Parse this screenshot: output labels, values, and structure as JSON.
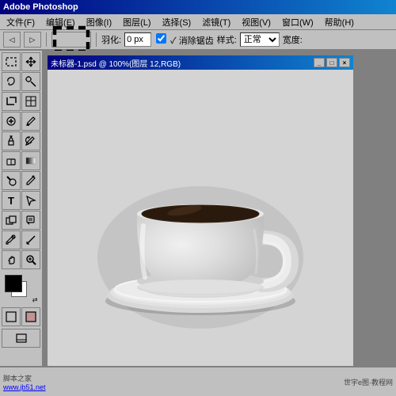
{
  "titleBar": {
    "label": "Adobe Photoshop"
  },
  "menuBar": {
    "items": [
      {
        "id": "file",
        "label": "文件(F)"
      },
      {
        "id": "edit",
        "label": "编辑(E)"
      },
      {
        "id": "image",
        "label": "图像(I)"
      },
      {
        "id": "layer",
        "label": "图层(L)"
      },
      {
        "id": "select",
        "label": "选择(S)"
      },
      {
        "id": "filter",
        "label": "滤镜(T)"
      },
      {
        "id": "view",
        "label": "视图(V)"
      },
      {
        "id": "window",
        "label": "窗口(W)"
      },
      {
        "id": "help",
        "label": "帮助(H)"
      }
    ]
  },
  "optionsBar": {
    "featherLabel": "羽化:",
    "featherValue": "0 px",
    "antialiasLabel": "✓ 消除锯齿",
    "styleLabel": "样式:",
    "styleValue": "正常",
    "widthLabel": "宽度:"
  },
  "docWindow": {
    "title": "未标器-1.psd @ 100%(图层 12,RGB)",
    "btnMinimize": "_",
    "btnMaximize": "□",
    "btnClose": "×"
  },
  "toolbox": {
    "tools": [
      {
        "id": "marquee-rect",
        "icon": "▭",
        "tooltip": "矩形选框"
      },
      {
        "id": "move",
        "icon": "✛",
        "tooltip": "移动"
      },
      {
        "id": "marquee-lasso",
        "icon": "⌇",
        "tooltip": "套索"
      },
      {
        "id": "magic-wand",
        "icon": "✦",
        "tooltip": "魔棒"
      },
      {
        "id": "crop",
        "icon": "⊞",
        "tooltip": "裁切"
      },
      {
        "id": "slice",
        "icon": "⊟",
        "tooltip": "切片"
      },
      {
        "id": "heal",
        "icon": "✚",
        "tooltip": "修复"
      },
      {
        "id": "brush",
        "icon": "✏",
        "tooltip": "画笔"
      },
      {
        "id": "stamp",
        "icon": "⊕",
        "tooltip": "仿制图章"
      },
      {
        "id": "history-brush",
        "icon": "↺",
        "tooltip": "历史画笔"
      },
      {
        "id": "eraser",
        "icon": "◻",
        "tooltip": "橡皮擦"
      },
      {
        "id": "gradient",
        "icon": "▦",
        "tooltip": "渐变"
      },
      {
        "id": "dodge",
        "icon": "◑",
        "tooltip": "减淡"
      },
      {
        "id": "pen",
        "icon": "✒",
        "tooltip": "钢笔"
      },
      {
        "id": "type",
        "icon": "T",
        "tooltip": "文字"
      },
      {
        "id": "path-select",
        "icon": "↖",
        "tooltip": "路径选择"
      },
      {
        "id": "shape",
        "icon": "■",
        "tooltip": "形状"
      },
      {
        "id": "notes",
        "icon": "✉",
        "tooltip": "注释"
      },
      {
        "id": "eyedropper",
        "icon": "⊘",
        "tooltip": "吸管"
      },
      {
        "id": "hand",
        "icon": "✋",
        "tooltip": "抓手"
      },
      {
        "id": "zoom",
        "icon": "⊕",
        "tooltip": "缩放"
      }
    ]
  },
  "bottomBar": {
    "watermark1": "脚本之家",
    "url1": "www.jb51.net",
    "watermark2": "世宇e图·教程网"
  },
  "colors": {
    "titleBarStart": "#000080",
    "titleBarEnd": "#1084d0",
    "background": "#c0c0c0",
    "canvasBg": "#808080",
    "docBg": "#d4d4d4",
    "saucerColor": "#d8d8d8",
    "cupColor": "#e0e0e0",
    "coffeeColor": "#2a1a0e",
    "shadowColor": "rgba(100,100,100,0.4)"
  }
}
